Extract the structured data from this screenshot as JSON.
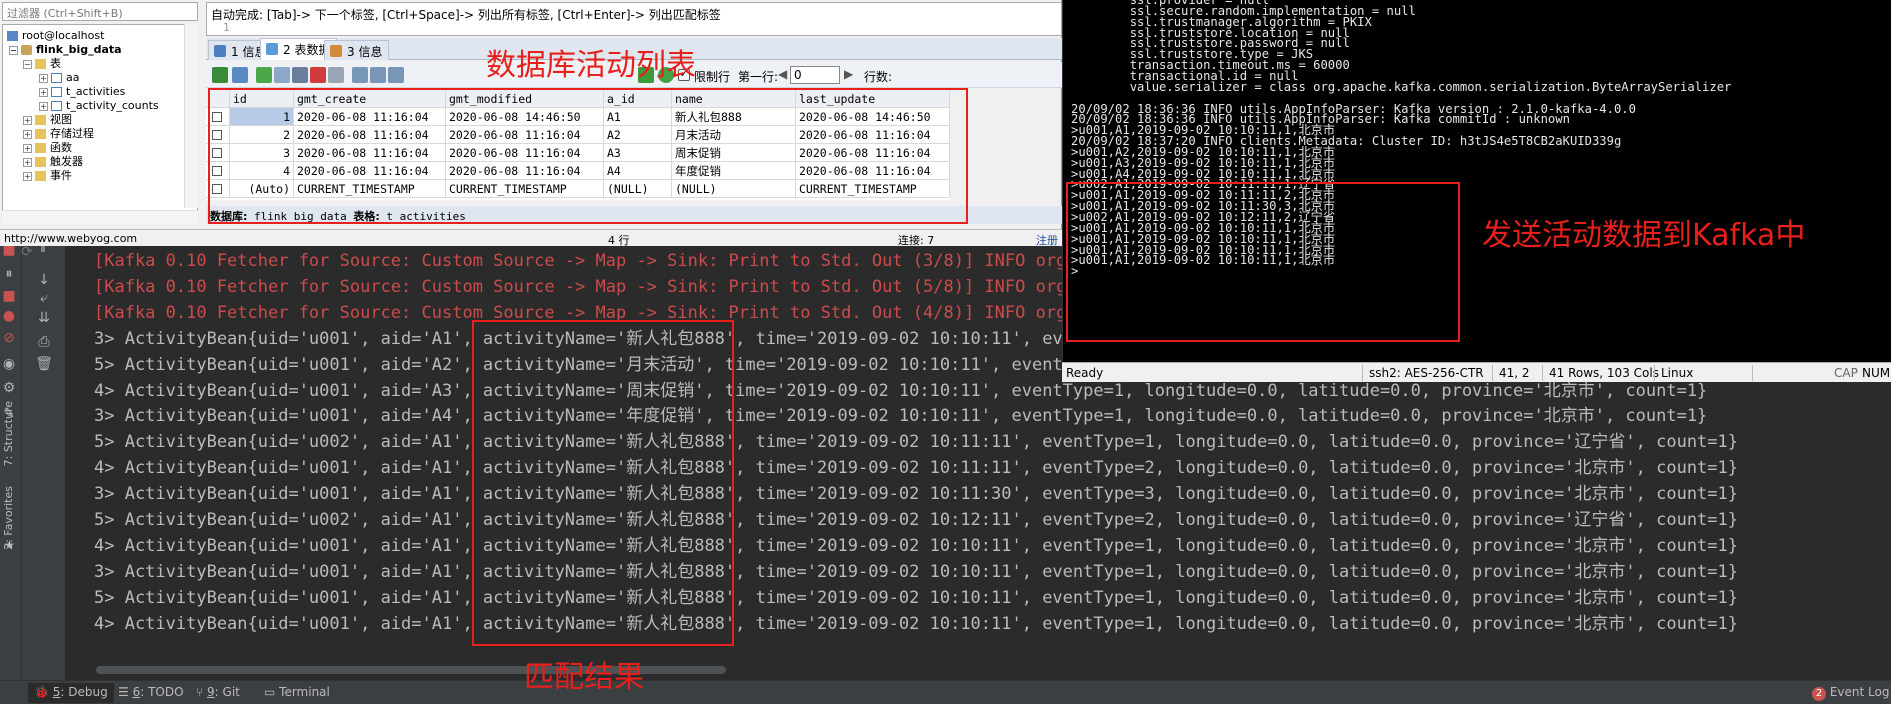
{
  "ide": {
    "console_lines": [
      {
        "text": "[Kafka 0.10 Fetcher for Source: Custom Source -> Map -> Sink: Print to Std. Out (3/8)] INFO org.a",
        "type": "err"
      },
      {
        "text": "[Kafka 0.10 Fetcher for Source: Custom Source -> Map -> Sink: Print to Std. Out (5/8)] INFO org.a",
        "type": "err"
      },
      {
        "text": "[Kafka 0.10 Fetcher for Source: Custom Source -> Map -> Sink: Print to Std. Out (4/8)] INFO org.a",
        "type": "err"
      },
      {
        "text": "3> ActivityBean{uid='u001', aid='A1', activityName='新人礼包888', time='2019-09-02 10:10:11', event",
        "type": "out"
      },
      {
        "text": "5> ActivityBean{uid='u001', aid='A2', activityName='月末活动', time='2019-09-02 10:10:11', eventTyp",
        "type": "out"
      },
      {
        "text": "4> ActivityBean{uid='u001', aid='A3', activityName='周末促销', time='2019-09-02 10:10:11', eventType=1, longitude=0.0, latitude=0.0, province='北京市', count=1}",
        "type": "out"
      },
      {
        "text": "3> ActivityBean{uid='u001', aid='A4', activityName='年度促销', time='2019-09-02 10:10:11', eventType=1, longitude=0.0, latitude=0.0, province='北京市', count=1}",
        "type": "out"
      },
      {
        "text": "5> ActivityBean{uid='u002', aid='A1', activityName='新人礼包888', time='2019-09-02 10:11:11', eventType=1, longitude=0.0, latitude=0.0, province='辽宁省', count=1}",
        "type": "out"
      },
      {
        "text": "4> ActivityBean{uid='u001', aid='A1', activityName='新人礼包888', time='2019-09-02 10:11:11', eventType=2, longitude=0.0, latitude=0.0, province='北京市', count=1}",
        "type": "out"
      },
      {
        "text": "3> ActivityBean{uid='u001', aid='A1', activityName='新人礼包888', time='2019-09-02 10:11:30', eventType=3, longitude=0.0, latitude=0.0, province='北京市', count=1}",
        "type": "out"
      },
      {
        "text": "5> ActivityBean{uid='u002', aid='A1', activityName='新人礼包888', time='2019-09-02 10:12:11', eventType=2, longitude=0.0, latitude=0.0, province='辽宁省', count=1}",
        "type": "out"
      },
      {
        "text": "4> ActivityBean{uid='u001', aid='A1', activityName='新人礼包888', time='2019-09-02 10:10:11', eventType=1, longitude=0.0, latitude=0.0, province='北京市', count=1}",
        "type": "out"
      },
      {
        "text": "3> ActivityBean{uid='u001', aid='A1', activityName='新人礼包888', time='2019-09-02 10:10:11', eventType=1, longitude=0.0, latitude=0.0, province='北京市', count=1}",
        "type": "out"
      },
      {
        "text": "5> ActivityBean{uid='u001', aid='A1', activityName='新人礼包888', time='2019-09-02 10:10:11', eventType=1, longitude=0.0, latitude=0.0, province='北京市', count=1}",
        "type": "out"
      },
      {
        "text": "4> ActivityBean{uid='u001', aid='A1', activityName='新人礼包888', time='2019-09-02 10:10:11', eventType=1, longitude=0.0, latitude=0.0, province='北京市', count=1}",
        "type": "out"
      }
    ],
    "left_tabs": {
      "structure": "7: Structure",
      "favorites": "2: Favorites"
    },
    "bottom_tabs": {
      "debug": {
        "num": "5",
        "label": ": Debug"
      },
      "todo": {
        "num": "6",
        "label": ": TODO"
      },
      "git": {
        "num": "9",
        "label": ": Git"
      },
      "terminal": "Terminal",
      "event_log": "Event Log",
      "event_log_count": "2"
    }
  },
  "sqlyog": {
    "filter_placeholder": "过滤器 (Ctrl+Shift+B)",
    "tree": {
      "server": "root@localhost",
      "database": "flink_big_data",
      "tables_folder": "表",
      "tables": [
        "aa",
        "t_activities",
        "t_activity_counts"
      ],
      "folders": [
        "视图",
        "存储过程",
        "函数",
        "触发器",
        "事件"
      ]
    },
    "sql_hint": "自动完成: [Tab]-> 下一个标签, [Ctrl+Space]-> 列出所有标签, [Ctrl+Enter]-> 列出匹配标签",
    "editor_line_number": "1",
    "tabs": [
      {
        "num": "1",
        "label": "信息"
      },
      {
        "num": "2",
        "label": "表数据"
      },
      {
        "num": "3",
        "label": "信息"
      }
    ],
    "toolbar": {
      "limit_label": "限制行",
      "first_row_label": "第一行:",
      "first_row_value": "0",
      "rows_label": "行数:"
    },
    "grid": {
      "columns": [
        "id",
        "gmt_create",
        "gmt_modified",
        "a_id",
        "name",
        "last_update"
      ],
      "rows": [
        [
          "1",
          "2020-06-08 11:16:04",
          "2020-06-08 14:46:50",
          "A1",
          "新人礼包888",
          "2020-06-08 14:46:50"
        ],
        [
          "2",
          "2020-06-08 11:16:04",
          "2020-06-08 11:16:04",
          "A2",
          "月末活动",
          "2020-06-08 11:16:04"
        ],
        [
          "3",
          "2020-06-08 11:16:04",
          "2020-06-08 11:16:04",
          "A3",
          "周末促销",
          "2020-06-08 11:16:04"
        ],
        [
          "4",
          "2020-06-08 11:16:04",
          "2020-06-08 11:16:04",
          "A4",
          "年度促销",
          "2020-06-08 11:16:04"
        ]
      ],
      "new_row": [
        "(Auto)",
        "CURRENT_TIMESTAMP",
        "CURRENT_TIMESTAMP",
        "(NULL)",
        "(NULL)",
        "CURRENT_TIMESTAMP"
      ]
    },
    "grid_status": {
      "db_label": "数据库:",
      "db_value": "flink_big_data",
      "table_label": "表格:",
      "table_value": "t_activities"
    },
    "statusbar": {
      "url": "http://www.webyog.com",
      "rows": "4 行",
      "connections": "连接: 7",
      "register": "注册"
    }
  },
  "terminal": {
    "lines": [
      "        ssl.provider = null",
      "        ssl.secure.random.implementation = null",
      "        ssl.trustmanager.algorithm = PKIX",
      "        ssl.truststore.location = null",
      "        ssl.truststore.password = null",
      "        ssl.truststore.type = JKS",
      "        transaction.timeout.ms = 60000",
      "        transactional.id = null",
      "        value.serializer = class org.apache.kafka.common.serialization.ByteArraySerializer",
      "",
      "20/09/02 18:36:36 INFO utils.AppInfoParser: Kafka version : 2.1.0-kafka-4.0.0",
      "20/09/02 18:36:36 INFO utils.AppInfoParser: Kafka commitId : unknown",
      ">u001,A1,2019-09-02 10:10:11,1,北京市",
      "20/09/02 18:37:20 INFO clients.Metadata: Cluster ID: h3tJS4e5T8CB2aKUID339g",
      ">u001,A2,2019-09-02 10:10:11,1,北京市",
      ">u001,A3,2019-09-02 10:10:11,1,北京市",
      ">u001,A4,2019-09-02 10:10:11,1,北京市",
      ">u002,A1,2019-09-02 10:11:11,1,辽宁省",
      ">u001,A1,2019-09-02 10:11:11,2,北京市",
      ">u001,A1,2019-09-02 10:11:30,3,北京市",
      ">u002,A1,2019-09-02 10:12:11,2,辽宁省",
      ">u001,A1,2019-09-02 10:10:11,1,北京市",
      ">u001,A1,2019-09-02 10:10:11,1,北京市",
      ">u001,A1,2019-09-02 10:10:11,1,北京市",
      ">u001,A1,2019-09-02 10:10:11,1,北京市",
      ">"
    ],
    "status": {
      "ready": "Ready",
      "cipher": "ssh2: AES-256-CTR",
      "cursor": "41,  2",
      "size": "41 Rows, 103 Cols",
      "os": "Linux",
      "caps": "CAP",
      "num": "NUM"
    }
  },
  "annotations": {
    "db_list": "数据库活动列表",
    "send_kafka": "发送活动数据到Kafka中",
    "match_result": "匹配结果"
  },
  "colors": {
    "annotation_red": "#e8201c",
    "console_error": "#cc4b4b",
    "console_text": "#bbbbbb"
  }
}
